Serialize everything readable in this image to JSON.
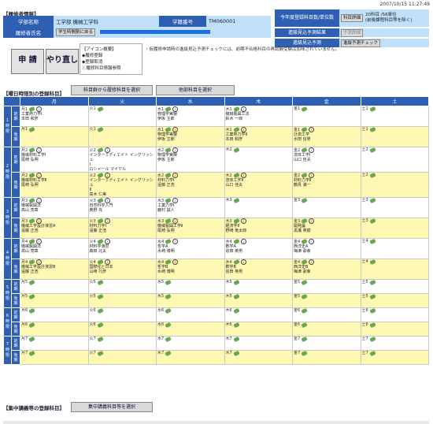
{
  "timestamp": "2007/10/15 11:27:49",
  "header": {
    "section_title": "【履修者情報】",
    "dept_label": "学部名称",
    "dept_value": "工学部 機械工学科",
    "student_no_label": "学籍番号",
    "student_no_value": "TM060001",
    "name_label": "履修者氏名",
    "schedule_button": "学生時間割に戻る"
  },
  "right_panel": {
    "row1_label": "今年度登録科目数/単位数",
    "row1_button": "科目詳細",
    "row1_value": "20科目 /56単位",
    "row1_value2": "(前後課程科目等を除く)",
    "row2_label": "進級見込予測結果",
    "row2_button": "予測詳細",
    "row3_label": "進級見込予測",
    "row3_button": "進級予測チェック"
  },
  "actions": {
    "apply": "申 請",
    "redo": "やり直し"
  },
  "legend": {
    "title": "【アイコン概要】",
    "items": [
      "◆履修登録",
      "◆登録取消",
      "ⓘ履修科目情報参照"
    ]
  },
  "note": "・仮履修申請時の進級見込予測チェックには、前期不合格科目の再試験受験は加味されていません。",
  "weekly": {
    "title": "【曜日時限別の登録科目】",
    "btn_subject": "科目群から履修科目を選択",
    "btn_other": "他部科目を選択",
    "days": [
      "月",
      "火",
      "水",
      "木",
      "金",
      "土"
    ],
    "periods": [
      {
        "label": "1時限",
        "rows": [
          {
            "kb": "前期",
            "cells": [
              {
                "head": "月1",
                "icons": true,
                "lines": [
                  "工業熱力学Ⅰ",
                  "本田 和彦"
                ]
              },
              {
                "head": "火1",
                "icons": false,
                "lines": []
              },
              {
                "head": "水1",
                "icons": true,
                "lines": [
                  "物理学実験",
                  "伊坂 主郎"
                ]
              },
              {
                "head": "木1",
                "icons": true,
                "lines": [
                  "機械製図工法",
                  "鈴木 一郎"
                ]
              },
              {
                "head": "金1",
                "icons": false,
                "lines": []
              },
              {
                "head": "土1",
                "icons": false,
                "lines": []
              }
            ]
          },
          {
            "kb": "後期",
            "cells": [
              {
                "head": "月1",
                "icons": false,
                "lines": []
              },
              {
                "head": "火1",
                "icons": false,
                "lines": []
              },
              {
                "head": "水1",
                "icons": true,
                "lines": [
                  "物理学実験",
                  "伊坂 主郎"
                ]
              },
              {
                "head": "木1",
                "icons": true,
                "lines": [
                  "工業熱力学Ⅱ",
                  "本田 和彦"
                ]
              },
              {
                "head": "金1",
                "icons": true,
                "lines": [
                  "計測工学",
                  "水田 信男"
                ]
              },
              {
                "head": "土1",
                "icons": false,
                "lines": []
              }
            ]
          }
        ]
      },
      {
        "label": "2時限",
        "rows": [
          {
            "kb": "前期",
            "cells": [
              {
                "head": "月2",
                "icons": true,
                "lines": [
                  "機械材料工学Ⅰ",
                  "尾崎 弘明"
                ]
              },
              {
                "head": "火2",
                "icons": true,
                "lines": [
                  "インターミディエイト イングリッシュ",
                  "Ⅰ",
                  "ロシャール マイケル"
                ]
              },
              {
                "head": "水2",
                "icons": true,
                "lines": [
                  "物理学実験",
                  "伊坂 主郎"
                ]
              },
              {
                "head": "木2",
                "icons": false,
                "lines": []
              },
              {
                "head": "金2",
                "icons": true,
                "lines": [
                  "流体工学Ⅰ",
                  "山口 佳夫"
                ]
              },
              {
                "head": "土2",
                "icons": false,
                "lines": []
              }
            ]
          },
          {
            "kb": "後期",
            "cells": [
              {
                "head": "月2",
                "icons": true,
                "lines": [
                  "機械材料工学Ⅱ",
                  "尾崎 弘明"
                ]
              },
              {
                "head": "火2",
                "icons": true,
                "lines": [
                  "インターミディエイト イングリッシュ",
                  "Ⅱ",
                  "高木 仁美"
                ]
              },
              {
                "head": "水2",
                "icons": true,
                "lines": [
                  "材料力学Ⅰ",
                  "遠藤 正浩"
                ]
              },
              {
                "head": "木2",
                "icons": true,
                "lines": [
                  "流体工学Ⅱ",
                  "山口 佳夫"
                ]
              },
              {
                "head": "金2",
                "icons": true,
                "lines": [
                  "材料力学Ⅱ",
                  "鶴見 満一"
                ]
              },
              {
                "head": "土2",
                "icons": false,
                "lines": []
              }
            ]
          }
        ]
      },
      {
        "label": "3時限",
        "rows": [
          {
            "kb": "前期",
            "cells": [
              {
                "head": "月3",
                "icons": true,
                "lines": [
                  "機械製図法",
                  "高山 亮章"
                ]
              },
              {
                "head": "火3",
                "icons": true,
                "lines": [
                  "自然科学入門",
                  "奥野 充"
                ]
              },
              {
                "head": "水3",
                "icons": true,
                "lines": [
                  "工業力学Ⅰ",
                  "鹿村 誠人"
                ]
              },
              {
                "head": "木3",
                "icons": false,
                "lines": []
              },
              {
                "head": "金3",
                "icons": false,
                "lines": []
              },
              {
                "head": "土3",
                "icons": false,
                "lines": []
              }
            ]
          },
          {
            "kb": "後期",
            "cells": [
              {
                "head": "月3",
                "icons": true,
                "lines": [
                  "機械工学設計演習A",
                  "遠藤 正浩"
                ]
              },
              {
                "head": "火3",
                "icons": true,
                "lines": [
                  "材料力学Ⅰ",
                  "遠藤 正浩"
                ]
              },
              {
                "head": "水3",
                "icons": true,
                "lines": [
                  "機械製図工学Ⅱ",
                  "尾崎 弘明"
                ]
              },
              {
                "head": "木3",
                "icons": true,
                "lines": [
                  "経済学Ⅱ",
                  "野崎 竜太郎"
                ]
              },
              {
                "head": "金3",
                "icons": true,
                "lines": [
                  "開発論",
                  "黒瀬 英樹"
                ]
              },
              {
                "head": "土3",
                "icons": false,
                "lines": []
              }
            ]
          }
        ]
      },
      {
        "label": "4時限",
        "rows": [
          {
            "kb": "前期",
            "cells": [
              {
                "head": "月4",
                "icons": true,
                "lines": [
                  "機械製図法",
                  "高山 亮章"
                ]
              },
              {
                "head": "火4",
                "icons": true,
                "lines": [
                  "材料学演習",
                  "森田 北夫"
                ]
              },
              {
                "head": "水4",
                "icons": true,
                "lines": [
                  "哲学A",
                  "水崎 博明"
                ]
              },
              {
                "head": "木4",
                "icons": true,
                "lines": [
                  "數学A",
                  "追田 英男"
                ]
              },
              {
                "head": "金4",
                "icons": true,
                "lines": [
                  "西洋史A",
                  "梅津 歌孝"
                ]
              },
              {
                "head": "土4",
                "icons": false,
                "lines": []
              }
            ]
          },
          {
            "kb": "後期",
            "cells": [
              {
                "head": "月4",
                "icons": true,
                "lines": [
                  "機械工学設計演習B",
                  "遠藤 正浩"
                ]
              },
              {
                "head": "火4",
                "icons": true,
                "lines": [
                  "国際化と日本",
                  "山崎 行彦"
                ]
              },
              {
                "head": "水4",
                "icons": true,
                "lines": [
                  "哲学B",
                  "水崎 博明"
                ]
              },
              {
                "head": "木4",
                "icons": true,
                "lines": [
                  "數学B",
                  "追田 英男"
                ]
              },
              {
                "head": "金4",
                "icons": true,
                "lines": [
                  "西洋史B",
                  "梅津 歌孝"
                ]
              },
              {
                "head": "土4",
                "icons": false,
                "lines": []
              }
            ]
          }
        ]
      },
      {
        "label": "5時限",
        "rows": [
          {
            "kb": "前期",
            "cells": [
              {
                "head": "月5",
                "icons": false,
                "lines": []
              },
              {
                "head": "火5",
                "icons": false,
                "lines": []
              },
              {
                "head": "水5",
                "icons": false,
                "lines": []
              },
              {
                "head": "木5",
                "icons": false,
                "lines": []
              },
              {
                "head": "金5",
                "icons": false,
                "lines": []
              },
              {
                "head": "土5",
                "icons": false,
                "lines": []
              }
            ]
          },
          {
            "kb": "後期",
            "cells": [
              {
                "head": "月5",
                "icons": false,
                "lines": []
              },
              {
                "head": "火5",
                "icons": false,
                "lines": []
              },
              {
                "head": "水5",
                "icons": false,
                "lines": []
              },
              {
                "head": "木5",
                "icons": false,
                "lines": []
              },
              {
                "head": "金5",
                "icons": false,
                "lines": []
              },
              {
                "head": "土5",
                "icons": false,
                "lines": []
              }
            ]
          }
        ]
      },
      {
        "label": "6時限",
        "rows": [
          {
            "kb": "前期",
            "cells": [
              {
                "head": "月6",
                "icons": false,
                "lines": []
              },
              {
                "head": "火6",
                "icons": false,
                "lines": []
              },
              {
                "head": "水6",
                "icons": false,
                "lines": []
              },
              {
                "head": "木6",
                "icons": false,
                "lines": []
              },
              {
                "head": "金6",
                "icons": false,
                "lines": []
              },
              {
                "head": "土6",
                "icons": false,
                "lines": []
              }
            ]
          },
          {
            "kb": "後期",
            "cells": [
              {
                "head": "月6",
                "icons": false,
                "lines": []
              },
              {
                "head": "火6",
                "icons": false,
                "lines": []
              },
              {
                "head": "水6",
                "icons": false,
                "lines": []
              },
              {
                "head": "木6",
                "icons": false,
                "lines": []
              },
              {
                "head": "金6",
                "icons": false,
                "lines": []
              },
              {
                "head": "土6",
                "icons": false,
                "lines": []
              }
            ]
          }
        ]
      },
      {
        "label": "7時限",
        "rows": [
          {
            "kb": "前期",
            "cells": [
              {
                "head": "月7",
                "icons": false,
                "lines": []
              },
              {
                "head": "火7",
                "icons": false,
                "lines": []
              },
              {
                "head": "水7",
                "icons": false,
                "lines": []
              },
              {
                "head": "木7",
                "icons": false,
                "lines": []
              },
              {
                "head": "金7",
                "icons": false,
                "lines": []
              },
              {
                "head": "土7",
                "icons": false,
                "lines": []
              }
            ]
          },
          {
            "kb": "後期",
            "cells": [
              {
                "head": "月7",
                "icons": false,
                "lines": []
              },
              {
                "head": "火7",
                "icons": false,
                "lines": []
              },
              {
                "head": "水7",
                "icons": false,
                "lines": []
              },
              {
                "head": "木7",
                "icons": false,
                "lines": []
              },
              {
                "head": "金7",
                "icons": false,
                "lines": []
              },
              {
                "head": "土7",
                "icons": false,
                "lines": []
              }
            ]
          }
        ]
      }
    ]
  },
  "intensive": {
    "title": "【集中講義等の登録科目】",
    "button": "集中講義科目等を選択"
  },
  "colors": {
    "header_blue": "#2f5fb3",
    "light_blue": "#bfe0f8",
    "latter_yellow": "#fff8b3",
    "progress_blue": "#1b6fe0"
  }
}
